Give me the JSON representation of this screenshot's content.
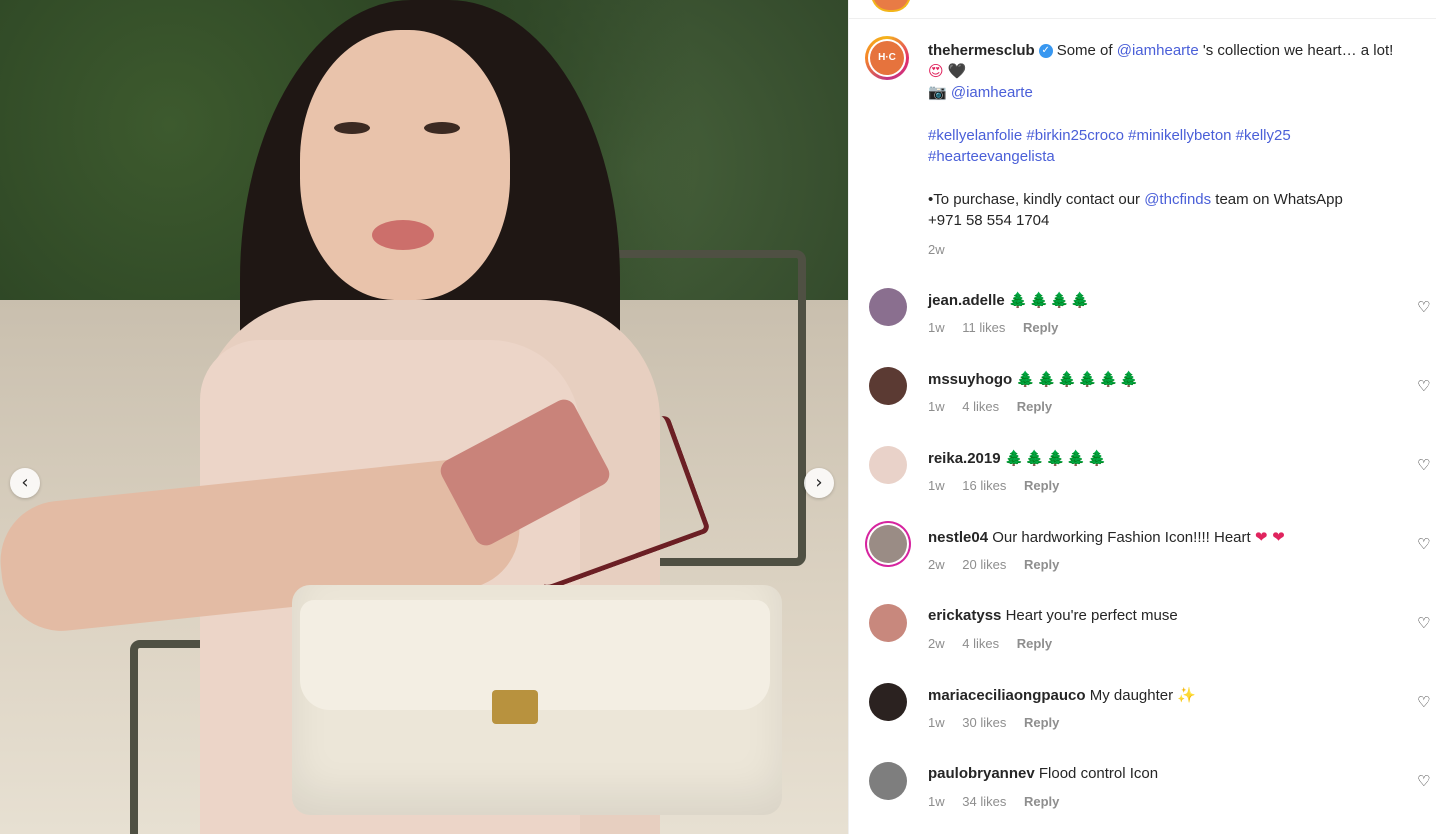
{
  "post": {
    "image_alt": "",
    "prev_arrow": "‹",
    "next_arrow": "›"
  },
  "caption": {
    "avatar_text": "H·C",
    "username": "thehermesclub",
    "verified_icon": "✓",
    "text_before_mention": "Some of ",
    "mention": "@iamhearte",
    "text_after_mention": " 's collection we heart… a lot!",
    "emoji_1": "😍",
    "emoji_2": "🖤",
    "camera_emoji": "📷",
    "credit_mention": "@iamhearte",
    "hashtags_line1": "#kellyelanfolie #birkin25croco #minikellybeton #kelly25",
    "hashtags_line2": "#hearteevangelista",
    "purchase_before": "•To purchase, kindly contact our ",
    "purchase_mention": "@thcfinds",
    "purchase_after": " team on WhatsApp",
    "phone": "+971 58 554 1704",
    "time": "2w"
  },
  "comments": [
    {
      "user": "jean.adelle",
      "text": "",
      "emoji": "🌲🌲🌲🌲",
      "emoji_class": "tree",
      "time": "1w",
      "likes": "11 likes",
      "reply": "Reply",
      "avatar_color": "#8a6f8f",
      "ring": false
    },
    {
      "user": "mssuyhogo",
      "text": "",
      "emoji": "🌲🌲🌲🌲🌲🌲",
      "emoji_class": "tree",
      "time": "1w",
      "likes": "4 likes",
      "reply": "Reply",
      "avatar_color": "#5b3a33",
      "ring": false
    },
    {
      "user": "reika.2019",
      "text": "",
      "emoji": "🌲🌲🌲🌲🌲",
      "emoji_class": "tree",
      "time": "1w",
      "likes": "16 likes",
      "reply": "Reply",
      "avatar_color": "#e9d2c9",
      "ring": false
    },
    {
      "user": "nestle04",
      "text": "Our hardworking Fashion Icon!!!! Heart",
      "emoji": "❤ ❤",
      "emoji_class": "red",
      "time": "2w",
      "likes": "20 likes",
      "reply": "Reply",
      "avatar_color": "#9a8c85",
      "ring": true
    },
    {
      "user": "erickatyss",
      "text": "Heart you're perfect muse",
      "emoji": "",
      "emoji_class": "",
      "time": "2w",
      "likes": "4 likes",
      "reply": "Reply",
      "avatar_color": "#c8887d",
      "ring": false
    },
    {
      "user": "mariaceciliaongpauco",
      "text": "My daughter",
      "emoji": "✨",
      "emoji_class": "gold",
      "time": "1w",
      "likes": "30 likes",
      "reply": "Reply",
      "avatar_color": "#2b2220",
      "ring": false
    },
    {
      "user": "paulobryannev",
      "text": "Flood control Icon",
      "emoji": "",
      "emoji_class": "",
      "time": "1w",
      "likes": "34 likes",
      "reply": "Reply",
      "avatar_color": "#7e7e7e",
      "ring": false
    }
  ],
  "icons": {
    "heart": "♡"
  }
}
